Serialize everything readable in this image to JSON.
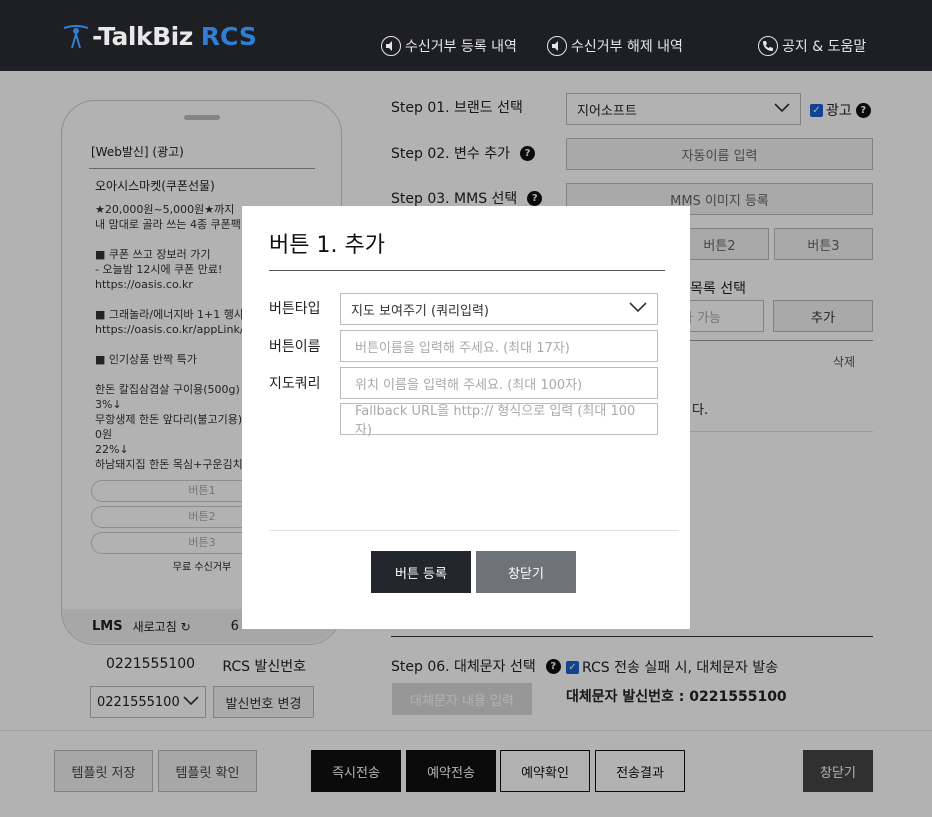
{
  "header": {
    "logo_text": "-TalkBiz",
    "logo_suffix": "RCS",
    "nav": [
      {
        "label": "수신거부 등록 내역"
      },
      {
        "label": "수신거부 해제 내역"
      },
      {
        "label": "공지 & 도움말"
      }
    ]
  },
  "preview": {
    "head": "[Web발신] (광고)",
    "title": "오아시스마켓(쿠폰선물)",
    "body": "★20,000원~5,000원★까지\n내 맘대로 골라 쓰는 4종 쿠폰팩\n\n■ 쿠폰 쓰고 장보러 가기\n- 오늘밤 12시에 쿠폰 만료!\nhttps://oasis.co.kr\n\n■ 그래놀라/에너지바 1+1 행사\nhttps://oasis.co.kr/appLink/K\n\n■ 인기상품 반짝 특가\n\n한돈 칼집삼겹살 구이용(500g)\n3%↓\n무항생제 한돈 앞다리(불고기용)\n0원\n22%↓\n하남돼지집 한돈 목심+구운김치",
    "buttons": [
      "버튼1",
      "버튼2",
      "버튼3"
    ],
    "footer": "무료 수신거부",
    "type": "LMS",
    "refresh": "새로고침",
    "count": "6"
  },
  "sender": {
    "number": "0221555100",
    "label": "RCS 발신번호",
    "selected": "0221555100",
    "change_btn": "발신번호 변경"
  },
  "steps": {
    "s1": {
      "label": "Step 01. 브랜드 선택",
      "brand": "지어소프트",
      "ad_label": "광고"
    },
    "s2": {
      "label": "Step 02. 변수 추가",
      "btn": "자동이름 입력"
    },
    "s3": {
      "label": "Step 03. MMS 선택",
      "btn": "MMS 이미지 등록"
    },
    "s4": {
      "btn2": "버튼2",
      "btn3": "버튼3"
    },
    "s5": {
      "label_partial": "목록 선택",
      "input_partial": "가 가능",
      "add": "추가",
      "col_delete": "삭제",
      "row_partial": "다."
    },
    "s6": {
      "label": "Step 06. 대체문자 선택",
      "check_label": "RCS 전송 실패 시, 대체문자 발송",
      "btn": "대체문자 내용 입력",
      "sender_text": "대체문자 발신번호 : 0221555100"
    }
  },
  "bottom": {
    "save": "템플릿 저장",
    "check": "템플릿 확인",
    "send_now": "즉시전송",
    "reserve": "예약전송",
    "reserve_check": "예약확인",
    "result": "전송결과",
    "close": "창닫기"
  },
  "modal": {
    "title": "버튼 1. 추가",
    "type_label": "버튼타입",
    "type_value": "지도 보여주기 (쿼리입력)",
    "name_label": "버튼이름",
    "name_placeholder": "버튼이름을 입력해 주세요. (최대 17자)",
    "query_label": "지도쿼리",
    "query_placeholder": "위치 이름을 입력해 주세요. (최대 100자)",
    "fallback_placeholder": "Fallback URL을 http:// 형식으로 입력 (최대 100자)",
    "register": "버튼 등록",
    "close": "창닫기"
  },
  "colors": {
    "header_bg": "#1e1f22",
    "rcs_blue": "#2f7fd9",
    "register_btn": "#23262c",
    "close_btn": "#6f7276"
  }
}
